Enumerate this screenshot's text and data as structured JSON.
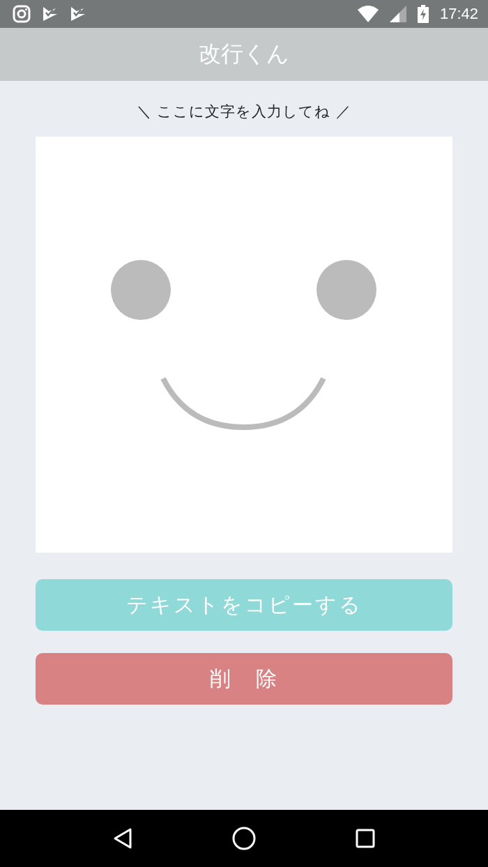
{
  "status_bar": {
    "time": "17:42"
  },
  "header": {
    "title": "改行くん"
  },
  "prompt": "＼ ここに文字を入力してね ／",
  "buttons": [
    {
      "kind": "copy",
      "label": "テキストをコピーする"
    },
    {
      "kind": "delete",
      "label": "削　除"
    }
  ]
}
